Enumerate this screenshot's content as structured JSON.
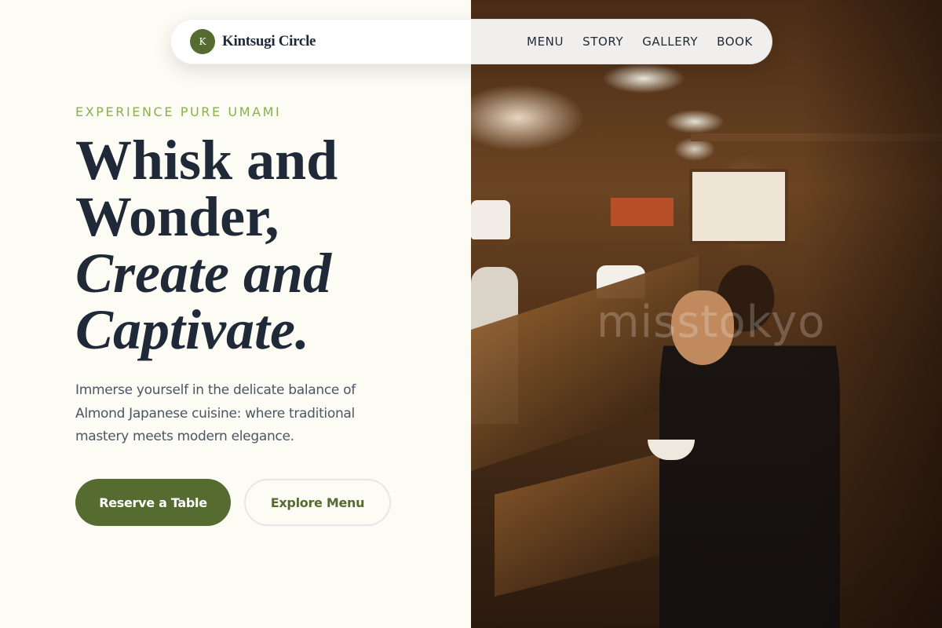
{
  "nav": {
    "brand_mark": "K",
    "brand_name": "Kintsugi Circle",
    "links": [
      "MENU",
      "STORY",
      "GALLERY",
      "BOOK"
    ]
  },
  "hero": {
    "eyebrow": "EXPERIENCE PURE UMAMI",
    "headline_line1": "Whisk and",
    "headline_line2": "Wonder,",
    "headline_line3": "Create and",
    "headline_line4": "Captivate.",
    "description": "Immerse yourself in the delicate balance of Almond Japanese cuisine: where traditional mastery meets modern elegance.",
    "primary_button": "Reserve a Table",
    "secondary_button": "Explore Menu"
  },
  "photo": {
    "watermark": "misstokyo"
  },
  "colors": {
    "accent": "#556b2f",
    "eyebrow": "#8ab04a",
    "background": "#fcfcf5",
    "heading": "#1f2937"
  }
}
